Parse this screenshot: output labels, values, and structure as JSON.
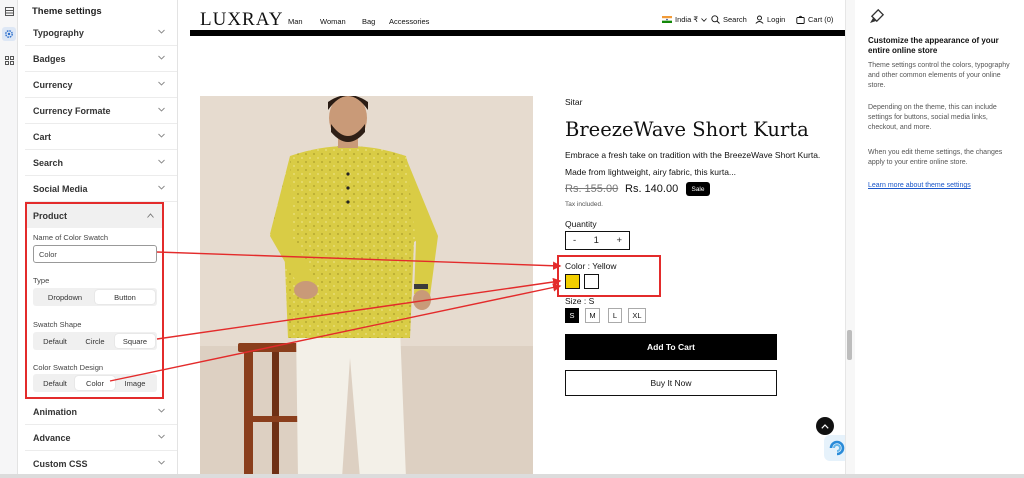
{
  "settings": {
    "title": "Theme settings",
    "sections": [
      "Typography",
      "Badges",
      "Currency",
      "Currency Formate",
      "Cart",
      "Search",
      "Social Media"
    ],
    "sections_after": [
      "Animation",
      "Advance",
      "Custom CSS"
    ],
    "product": {
      "header": "Product",
      "swatch_name_label": "Name of Color Swatch",
      "swatch_name_value": "Color",
      "type_label": "Type",
      "type_options": [
        "Dropdown",
        "Button"
      ],
      "type_selected": "Button",
      "shape_label": "Swatch Shape",
      "shape_options": [
        "Default",
        "Circle",
        "Square"
      ],
      "shape_selected": "Square",
      "design_label": "Color Swatch Design",
      "design_options": [
        "Default",
        "Color",
        "Image"
      ],
      "design_selected": "Color"
    }
  },
  "store": {
    "logo": "LUXRAY",
    "nav": [
      "Man",
      "Woman",
      "Bag",
      "Accessories"
    ],
    "country": "India ₹",
    "search": "Search",
    "login": "Login",
    "cart": "Cart (0)",
    "vendor": "Sitar",
    "product_title": "BreezeWave Short Kurta",
    "description": "Embrace a fresh take on tradition with the BreezeWave Short Kurta. Made from lightweight, airy fabric, this kurta...",
    "price_old": "Rs. 155.00",
    "price_new": "Rs. 140.00",
    "sale_badge": "Sale",
    "tax_note": "Tax included.",
    "quantity_label": "Quantity",
    "quantity": "1",
    "qty_minus": "-",
    "qty_plus": "+",
    "color_label": "Color : Yellow",
    "swatches": [
      {
        "name": "Yellow",
        "color": "#f2cf00",
        "selected": true
      },
      {
        "name": "White",
        "color": "#ffffff",
        "selected": false
      }
    ],
    "size_label": "Size : S",
    "sizes": [
      "S",
      "M",
      "L",
      "XL"
    ],
    "size_selected": "S",
    "add_to_cart": "Add To Cart",
    "buy_now": "Buy It Now"
  },
  "help": {
    "title": "Customize the appearance of your entire online store",
    "p1": "Theme settings control the colors, typography and other common elements of your online store.",
    "p2": "Depending on the theme, this can include settings for buttons, social media links, checkout, and more.",
    "p3": "When you edit theme settings, the changes apply to your entire online store.",
    "link": "Learn more about theme settings"
  },
  "colors": {
    "annotation": "#e32b2b",
    "swatch_yellow": "#f2cf00",
    "link": "#1a56c8"
  }
}
